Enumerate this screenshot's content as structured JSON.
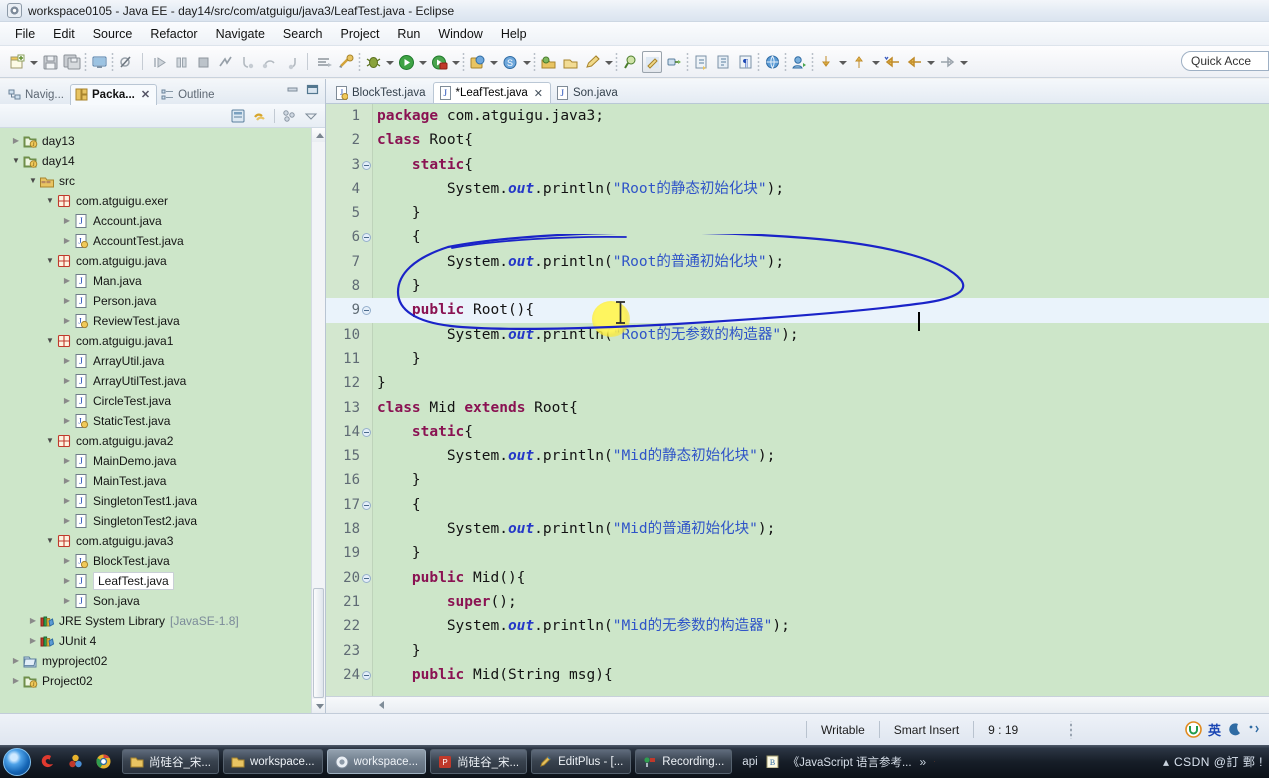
{
  "window": {
    "title": "workspace0105 - Java EE - day14/src/com/atguigu/java3/LeafTest.java - Eclipse",
    "app_icon": "eclipse-icon"
  },
  "menubar": {
    "items": [
      "File",
      "Edit",
      "Source",
      "Refactor",
      "Navigate",
      "Search",
      "Project",
      "Run",
      "Window",
      "Help"
    ]
  },
  "toolbar": {
    "quick_access_placeholder": "Quick Acce",
    "icons": [
      "new-wizard-icon",
      "save-icon",
      "save-all-icon",
      "console-icon",
      "skip-breakpoints-icon",
      "resume-icon",
      "suspend-icon",
      "terminate-icon",
      "disconnect-icon",
      "step-into-icon",
      "step-over-icon",
      "step-return-icon",
      "run-last-tool-icon",
      "external-tools-icon",
      "debug-icon",
      "run-icon",
      "coverage-icon",
      "new-java-project-icon",
      "new-package-icon",
      "open-type-icon",
      "open-task-icon",
      "pencil-icon",
      "search-icon",
      "toggle-mark-occurrences-icon",
      "link-icon",
      "next-annotation-icon",
      "previous-annotation-icon",
      "pilcrow-icon",
      "web-browser-icon",
      "new-connection-icon",
      "backward-icon",
      "forward-icon",
      "back-history-icon",
      "forward-history-icon",
      "next-edit-icon"
    ]
  },
  "left_view": {
    "tabs": [
      {
        "label": "Navig...",
        "icon": "navigator-icon",
        "active": false,
        "closable": false
      },
      {
        "label": "Packa...",
        "icon": "package-explorer-icon",
        "active": true,
        "closable": true
      },
      {
        "label": "Outline",
        "icon": "outline-icon",
        "active": false,
        "closable": false
      }
    ],
    "window_buttons": [
      "minimize-button",
      "maximize-button"
    ],
    "view_toolbar": [
      "collapse-all-icon",
      "link-with-editor-icon",
      "view-menu-icon",
      "view-dropdown-icon"
    ],
    "tree": [
      {
        "label": "day13",
        "indent": 0,
        "twisty": "collapsed",
        "icon": "java-project-icon",
        "selected": false
      },
      {
        "label": "day14",
        "indent": 0,
        "twisty": "expanded",
        "icon": "java-project-icon",
        "selected": false
      },
      {
        "label": "src",
        "indent": 1,
        "twisty": "expanded",
        "icon": "source-folder-icon",
        "selected": false
      },
      {
        "label": "com.atguigu.exer",
        "indent": 2,
        "twisty": "expanded",
        "icon": "package-icon",
        "selected": false
      },
      {
        "label": "Account.java",
        "indent": 3,
        "twisty": "collapsed",
        "icon": "java-file-icon",
        "selected": false
      },
      {
        "label": "AccountTest.java",
        "indent": 3,
        "twisty": "collapsed",
        "icon": "java-file-main-icon",
        "selected": false
      },
      {
        "label": "com.atguigu.java",
        "indent": 2,
        "twisty": "expanded",
        "icon": "package-icon",
        "selected": false
      },
      {
        "label": "Man.java",
        "indent": 3,
        "twisty": "collapsed",
        "icon": "java-file-icon",
        "selected": false
      },
      {
        "label": "Person.java",
        "indent": 3,
        "twisty": "collapsed",
        "icon": "java-file-icon",
        "selected": false
      },
      {
        "label": "ReviewTest.java",
        "indent": 3,
        "twisty": "collapsed",
        "icon": "java-file-main-icon",
        "selected": false
      },
      {
        "label": "com.atguigu.java1",
        "indent": 2,
        "twisty": "expanded",
        "icon": "package-icon",
        "selected": false
      },
      {
        "label": "ArrayUtil.java",
        "indent": 3,
        "twisty": "collapsed",
        "icon": "java-file-icon",
        "selected": false
      },
      {
        "label": "ArrayUtilTest.java",
        "indent": 3,
        "twisty": "collapsed",
        "icon": "java-file-icon",
        "selected": false
      },
      {
        "label": "CircleTest.java",
        "indent": 3,
        "twisty": "collapsed",
        "icon": "java-file-icon",
        "selected": false
      },
      {
        "label": "StaticTest.java",
        "indent": 3,
        "twisty": "collapsed",
        "icon": "java-file-main-icon",
        "selected": false
      },
      {
        "label": "com.atguigu.java2",
        "indent": 2,
        "twisty": "expanded",
        "icon": "package-icon",
        "selected": false
      },
      {
        "label": "MainDemo.java",
        "indent": 3,
        "twisty": "collapsed",
        "icon": "java-file-icon",
        "selected": false
      },
      {
        "label": "MainTest.java",
        "indent": 3,
        "twisty": "collapsed",
        "icon": "java-file-icon",
        "selected": false
      },
      {
        "label": "SingletonTest1.java",
        "indent": 3,
        "twisty": "collapsed",
        "icon": "java-file-icon",
        "selected": false
      },
      {
        "label": "SingletonTest2.java",
        "indent": 3,
        "twisty": "collapsed",
        "icon": "java-file-icon",
        "selected": false
      },
      {
        "label": "com.atguigu.java3",
        "indent": 2,
        "twisty": "expanded",
        "icon": "package-icon",
        "selected": false
      },
      {
        "label": "BlockTest.java",
        "indent": 3,
        "twisty": "collapsed",
        "icon": "java-file-main-icon",
        "selected": false
      },
      {
        "label": "LeafTest.java",
        "indent": 3,
        "twisty": "collapsed",
        "icon": "java-file-icon",
        "selected": true
      },
      {
        "label": "Son.java",
        "indent": 3,
        "twisty": "collapsed",
        "icon": "java-file-icon",
        "selected": false
      },
      {
        "label": "JRE System Library",
        "suffix": "[JavaSE-1.8]",
        "indent": 1,
        "twisty": "collapsed",
        "icon": "library-icon",
        "selected": false
      },
      {
        "label": "JUnit 4",
        "indent": 1,
        "twisty": "collapsed",
        "icon": "library-icon",
        "selected": false
      },
      {
        "label": "myproject02",
        "indent": 0,
        "twisty": "collapsed",
        "icon": "closed-project-icon",
        "selected": false
      },
      {
        "label": "Project02",
        "indent": 0,
        "twisty": "collapsed",
        "icon": "java-project-icon",
        "selected": false
      }
    ]
  },
  "editor": {
    "tabs": [
      {
        "label": "BlockTest.java",
        "icon": "java-file-main-icon",
        "active": false,
        "dirty": false,
        "closable": false
      },
      {
        "label": "*LeafTest.java",
        "icon": "java-file-icon",
        "active": true,
        "dirty": true,
        "closable": true
      },
      {
        "label": "Son.java",
        "icon": "java-file-icon",
        "active": false,
        "dirty": false,
        "closable": false
      }
    ],
    "current_line": 9,
    "lines": [
      {
        "n": 1,
        "fold": false,
        "indent": 0,
        "tokens": [
          {
            "t": "package",
            "c": "kw"
          },
          {
            "t": " com.atguigu.java3;",
            "c": ""
          }
        ]
      },
      {
        "n": 2,
        "fold": false,
        "indent": 0,
        "tokens": [
          {
            "t": "class",
            "c": "kw"
          },
          {
            "t": " Root{",
            "c": ""
          }
        ]
      },
      {
        "n": 3,
        "fold": true,
        "indent": 1,
        "tokens": [
          {
            "t": "static",
            "c": "kw"
          },
          {
            "t": "{",
            "c": ""
          }
        ]
      },
      {
        "n": 4,
        "fold": false,
        "indent": 2,
        "tokens": [
          {
            "t": "System.",
            "c": ""
          },
          {
            "t": "out",
            "c": "fld"
          },
          {
            "t": ".println(",
            "c": ""
          },
          {
            "t": "\"Root的静态初始化块\"",
            "c": "str"
          },
          {
            "t": ");",
            "c": ""
          }
        ]
      },
      {
        "n": 5,
        "fold": false,
        "indent": 1,
        "tokens": [
          {
            "t": "}",
            "c": ""
          }
        ]
      },
      {
        "n": 6,
        "fold": true,
        "indent": 1,
        "tokens": [
          {
            "t": "{",
            "c": ""
          }
        ]
      },
      {
        "n": 7,
        "fold": false,
        "indent": 2,
        "tokens": [
          {
            "t": "System.",
            "c": ""
          },
          {
            "t": "out",
            "c": "fld"
          },
          {
            "t": ".println(",
            "c": ""
          },
          {
            "t": "\"Root的普通初始化块\"",
            "c": "str"
          },
          {
            "t": ");",
            "c": ""
          }
        ]
      },
      {
        "n": 8,
        "fold": false,
        "indent": 1,
        "tokens": [
          {
            "t": "}",
            "c": ""
          }
        ]
      },
      {
        "n": 9,
        "fold": true,
        "indent": 1,
        "tokens": [
          {
            "t": "public",
            "c": "kw"
          },
          {
            "t": " Root(){",
            "c": ""
          }
        ]
      },
      {
        "n": 10,
        "fold": false,
        "indent": 2,
        "tokens": [
          {
            "t": "System.",
            "c": ""
          },
          {
            "t": "out",
            "c": "fld"
          },
          {
            "t": ".println(",
            "c": ""
          },
          {
            "t": "\"Root的无参数的构造器\"",
            "c": "str"
          },
          {
            "t": ");",
            "c": ""
          }
        ]
      },
      {
        "n": 11,
        "fold": false,
        "indent": 1,
        "tokens": [
          {
            "t": "}",
            "c": ""
          }
        ]
      },
      {
        "n": 12,
        "fold": false,
        "indent": 0,
        "tokens": [
          {
            "t": "}",
            "c": ""
          }
        ]
      },
      {
        "n": 13,
        "fold": false,
        "indent": 0,
        "tokens": [
          {
            "t": "class",
            "c": "kw"
          },
          {
            "t": " Mid ",
            "c": ""
          },
          {
            "t": "extends",
            "c": "kw"
          },
          {
            "t": " Root{",
            "c": ""
          }
        ]
      },
      {
        "n": 14,
        "fold": true,
        "indent": 1,
        "tokens": [
          {
            "t": "static",
            "c": "kw"
          },
          {
            "t": "{",
            "c": ""
          }
        ]
      },
      {
        "n": 15,
        "fold": false,
        "indent": 2,
        "tokens": [
          {
            "t": "System.",
            "c": ""
          },
          {
            "t": "out",
            "c": "fld"
          },
          {
            "t": ".println(",
            "c": ""
          },
          {
            "t": "\"Mid的静态初始化块\"",
            "c": "str"
          },
          {
            "t": ");",
            "c": ""
          }
        ]
      },
      {
        "n": 16,
        "fold": false,
        "indent": 1,
        "tokens": [
          {
            "t": "}",
            "c": ""
          }
        ]
      },
      {
        "n": 17,
        "fold": true,
        "indent": 1,
        "tokens": [
          {
            "t": "{",
            "c": ""
          }
        ]
      },
      {
        "n": 18,
        "fold": false,
        "indent": 2,
        "tokens": [
          {
            "t": "System.",
            "c": ""
          },
          {
            "t": "out",
            "c": "fld"
          },
          {
            "t": ".println(",
            "c": ""
          },
          {
            "t": "\"Mid的普通初始化块\"",
            "c": "str"
          },
          {
            "t": ");",
            "c": ""
          }
        ]
      },
      {
        "n": 19,
        "fold": false,
        "indent": 1,
        "tokens": [
          {
            "t": "}",
            "c": ""
          }
        ]
      },
      {
        "n": 20,
        "fold": true,
        "indent": 1,
        "tokens": [
          {
            "t": "public",
            "c": "kw"
          },
          {
            "t": " Mid(){",
            "c": ""
          }
        ]
      },
      {
        "n": 21,
        "fold": false,
        "indent": 2,
        "tokens": [
          {
            "t": "super",
            "c": "kw"
          },
          {
            "t": "();",
            "c": ""
          }
        ]
      },
      {
        "n": 22,
        "fold": false,
        "indent": 2,
        "tokens": [
          {
            "t": "System.",
            "c": ""
          },
          {
            "t": "out",
            "c": "fld"
          },
          {
            "t": ".println(",
            "c": ""
          },
          {
            "t": "\"Mid的无参数的构造器\"",
            "c": "str"
          },
          {
            "t": ");",
            "c": ""
          }
        ]
      },
      {
        "n": 23,
        "fold": false,
        "indent": 1,
        "tokens": [
          {
            "t": "}",
            "c": ""
          }
        ]
      },
      {
        "n": 24,
        "fold": true,
        "indent": 1,
        "tokens": [
          {
            "t": "public",
            "c": "kw"
          },
          {
            "t": " Mid(String msg){",
            "c": ""
          }
        ]
      }
    ],
    "annotation": {
      "type": "hand-drawn-ellipse",
      "color": "#1a23c8",
      "encircles_lines": [
        9,
        10,
        11
      ]
    },
    "mouse_highlight_color": "#f5e63c"
  },
  "statusbar": {
    "writable": "Writable",
    "insert_mode": "Smart Insert",
    "cursor_position": "9 : 19",
    "ime_label": "英"
  },
  "taskbar": {
    "start_button": "windows-start-orb",
    "quick_launch": [
      "sogou-icon",
      "colorful-app-icon",
      "chrome-icon"
    ],
    "buttons": [
      {
        "label": "尚硅谷_宋...",
        "icon": "folder-icon",
        "active": false
      },
      {
        "label": "workspace...",
        "icon": "folder-icon",
        "active": false
      },
      {
        "label": "workspace...",
        "icon": "eclipse-icon",
        "active": true
      },
      {
        "label": "尚硅谷_宋...",
        "icon": "powerpoint-icon",
        "active": false
      },
      {
        "label": "EditPlus - [...",
        "icon": "editplus-icon",
        "active": false
      },
      {
        "label": "Recording...",
        "icon": "recording-icon",
        "active": false
      }
    ],
    "tray_text_items": [
      "api",
      "《JavaScript 语言参考..."
    ],
    "tray_overflow": "»",
    "tray_icons": [
      "sogou-s-icon",
      "show-hidden-icons-icon"
    ],
    "watermark": "CSDN @訂 鄄 !  "
  }
}
